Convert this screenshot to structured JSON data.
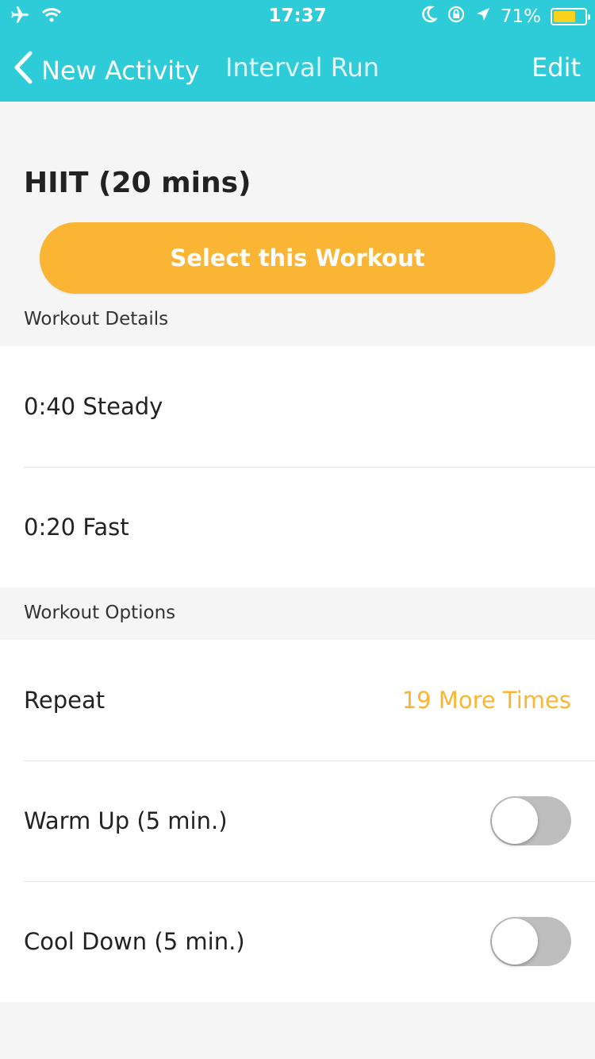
{
  "status_bar": {
    "time": "17:37",
    "battery_percent": "71%",
    "battery_level": 0.71,
    "icons": [
      "airplane-icon",
      "wifi-icon",
      "moon-icon",
      "rotation-lock-icon",
      "location-arrow-icon",
      "battery-icon"
    ]
  },
  "nav": {
    "back_label": "New Activity",
    "title": "Interval Run",
    "edit_label": "Edit"
  },
  "workout": {
    "title": "HIIT (20 mins)",
    "select_label": "Select this Workout"
  },
  "details": {
    "label": "Workout Details",
    "items": [
      "0:40 Steady",
      "0:20 Fast"
    ]
  },
  "options": {
    "label": "Workout Options",
    "repeat_label": "Repeat",
    "repeat_value": "19 More Times",
    "warm_up_label": "Warm Up (5 min.)",
    "warm_up_on": false,
    "cool_down_label": "Cool Down (5 min.)",
    "cool_down_on": false
  },
  "colors": {
    "header": "#2ecbd8",
    "accent": "#fbb535",
    "toggle_off": "#bdbdbd"
  }
}
